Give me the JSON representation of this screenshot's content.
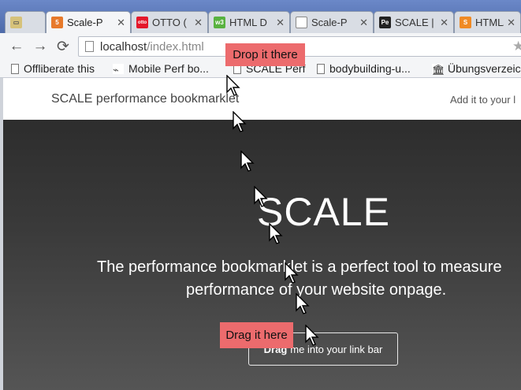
{
  "tabs": [
    {
      "label": "",
      "icon": "xampp-icon"
    },
    {
      "label": "Scale-P",
      "icon": "html-icon",
      "active": true
    },
    {
      "label": "OTTO (",
      "icon": "otto-icon"
    },
    {
      "label": "HTML D",
      "icon": "w3-icon"
    },
    {
      "label": "Scale-P",
      "icon": "page-icon"
    },
    {
      "label": "SCALE |",
      "icon": "scale-icon"
    },
    {
      "label": "HTML/",
      "icon": "s-icon"
    }
  ],
  "toolbar": {
    "back_icon": "←",
    "forward_icon": "→",
    "reload_icon": "⟳",
    "url_host": "localhost",
    "url_path": "/index.html",
    "star_icon": "★"
  },
  "bookmarks": [
    "Offliberate this",
    "Mobile Perf bo...",
    "SCALE Perf",
    "bodybuilding-u...",
    "Übungsverzeic"
  ],
  "site": {
    "brand": "SCALE performance bookmarklet",
    "nav_hint": "Add it to your l",
    "hero_title": "SCALE",
    "hero_line1": "The performance bookmarklet is a perfect tool to measure",
    "hero_line2": "performance of your website onpage.",
    "drag_bold": "Drag",
    "drag_rest": "me into your link bar"
  },
  "annotations": {
    "drop_label": "Drop it there",
    "drag_label": "Drag it here"
  }
}
